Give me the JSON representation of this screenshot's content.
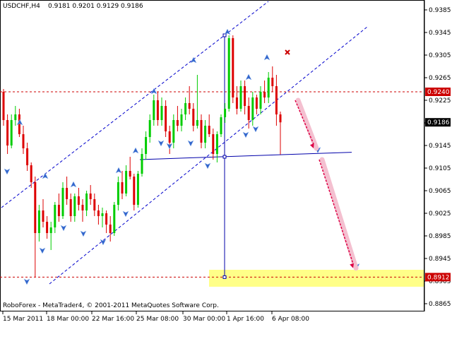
{
  "header": {
    "symbol": "USDCHF,H4",
    "ohlc": "0.9181 0.9201 0.9129 0.9186"
  },
  "footer": {
    "copyright": "RoboForex - MetaTrader4, © 2001-2011 MetaQuotes Software Corp."
  },
  "colors": {
    "bull": "#00cc00",
    "bear": "#dd0000",
    "level_line": "#cc0000",
    "channel": "#0000cc",
    "neckline": "#0000aa",
    "arrow_marker": "#3366cc",
    "target_zone": "#ffff88",
    "forecast_arrow": "#dd0044",
    "forecast_band": "#f4c0d0"
  },
  "chart_data": {
    "type": "candlestick",
    "y_range": [
      0.8855,
      0.94
    ],
    "y_ticks": [
      "0.9385",
      "0.9345",
      "0.9305",
      "0.9265",
      "0.9225",
      "0.9185",
      "0.9145",
      "0.9105",
      "0.9065",
      "0.9025",
      "0.8985",
      "0.8945",
      "0.8905",
      "0.8865"
    ],
    "x_ticks": [
      "15 Mar 2011",
      "18 Mar 00:00",
      "22 Mar 16:00",
      "25 Mar 08:00",
      "30 Mar 00:00",
      "1 Apr 16:00",
      "6 Apr 08:00"
    ],
    "levels": [
      {
        "label": "0.9240",
        "value": 0.924
      },
      {
        "label": "0.8912",
        "value": 0.8912
      }
    ],
    "current_price": {
      "label": "0.9186",
      "value": 0.9186
    },
    "candles": [
      [
        0.924,
        0.9245,
        0.918,
        0.919
      ],
      [
        0.919,
        0.92,
        0.913,
        0.9145
      ],
      [
        0.9145,
        0.92,
        0.914,
        0.919
      ],
      [
        0.919,
        0.9215,
        0.918,
        0.92
      ],
      [
        0.92,
        0.921,
        0.916,
        0.9165
      ],
      [
        0.9165,
        0.918,
        0.913,
        0.914
      ],
      [
        0.914,
        0.915,
        0.91,
        0.911
      ],
      [
        0.911,
        0.9115,
        0.907,
        0.908
      ],
      [
        0.908,
        0.909,
        0.8912,
        0.899
      ],
      [
        0.899,
        0.904,
        0.8975,
        0.903
      ],
      [
        0.903,
        0.905,
        0.9,
        0.901
      ],
      [
        0.901,
        0.902,
        0.898,
        0.899
      ],
      [
        0.899,
        0.901,
        0.896,
        0.9
      ],
      [
        0.9,
        0.9045,
        0.899,
        0.904
      ],
      [
        0.904,
        0.906,
        0.901,
        0.902
      ],
      [
        0.902,
        0.908,
        0.9015,
        0.907
      ],
      [
        0.907,
        0.909,
        0.904,
        0.905
      ],
      [
        0.905,
        0.906,
        0.901,
        0.902
      ],
      [
        0.902,
        0.906,
        0.901,
        0.9055
      ],
      [
        0.9055,
        0.907,
        0.903,
        0.904
      ],
      [
        0.904,
        0.905,
        0.901,
        0.903
      ],
      [
        0.903,
        0.9065,
        0.902,
        0.906
      ],
      [
        0.906,
        0.9075,
        0.904,
        0.905
      ],
      [
        0.905,
        0.906,
        0.902,
        0.903
      ],
      [
        0.903,
        0.904,
        0.9005,
        0.902
      ],
      [
        0.902,
        0.9035,
        0.9,
        0.9025
      ],
      [
        0.9025,
        0.903,
        0.899,
        0.9005
      ],
      [
        0.9005,
        0.902,
        0.8975,
        0.899
      ],
      [
        0.899,
        0.9045,
        0.8985,
        0.904
      ],
      [
        0.904,
        0.909,
        0.903,
        0.908
      ],
      [
        0.908,
        0.91,
        0.905,
        0.906
      ],
      [
        0.906,
        0.911,
        0.9055,
        0.91
      ],
      [
        0.91,
        0.9125,
        0.9085,
        0.909
      ],
      [
        0.909,
        0.9095,
        0.903,
        0.904
      ],
      [
        0.904,
        0.91,
        0.9035,
        0.9095
      ],
      [
        0.9095,
        0.914,
        0.909,
        0.913
      ],
      [
        0.913,
        0.917,
        0.912,
        0.916
      ],
      [
        0.916,
        0.92,
        0.915,
        0.919
      ],
      [
        0.919,
        0.9235,
        0.918,
        0.9225
      ],
      [
        0.9225,
        0.924,
        0.918,
        0.919
      ],
      [
        0.919,
        0.923,
        0.918,
        0.9215
      ],
      [
        0.9215,
        0.9225,
        0.916,
        0.917
      ],
      [
        0.917,
        0.918,
        0.913,
        0.915
      ],
      [
        0.915,
        0.92,
        0.914,
        0.919
      ],
      [
        0.919,
        0.9215,
        0.917,
        0.918
      ],
      [
        0.918,
        0.921,
        0.917,
        0.92
      ],
      [
        0.92,
        0.923,
        0.919,
        0.922
      ],
      [
        0.922,
        0.925,
        0.92,
        0.921
      ],
      [
        0.921,
        0.922,
        0.917,
        0.918
      ],
      [
        0.918,
        0.927,
        0.9175,
        0.919
      ],
      [
        0.919,
        0.92,
        0.914,
        0.915
      ],
      [
        0.915,
        0.919,
        0.914,
        0.918
      ],
      [
        0.918,
        0.92,
        0.916,
        0.9165
      ],
      [
        0.9165,
        0.9175,
        0.912,
        0.913
      ],
      [
        0.913,
        0.917,
        0.9115,
        0.9165
      ],
      [
        0.9165,
        0.92,
        0.916,
        0.9195
      ],
      [
        0.9195,
        0.922,
        0.9185,
        0.921
      ],
      [
        0.921,
        0.934,
        0.9205,
        0.9335
      ],
      [
        0.9335,
        0.934,
        0.922,
        0.923
      ],
      [
        0.923,
        0.925,
        0.92,
        0.921
      ],
      [
        0.921,
        0.926,
        0.9205,
        0.925
      ],
      [
        0.925,
        0.926,
        0.92,
        0.9215
      ],
      [
        0.9215,
        0.923,
        0.9175,
        0.919
      ],
      [
        0.919,
        0.924,
        0.918,
        0.923
      ],
      [
        0.923,
        0.9235,
        0.92,
        0.921
      ],
      [
        0.921,
        0.925,
        0.92,
        0.924
      ],
      [
        0.924,
        0.926,
        0.922,
        0.923
      ],
      [
        0.923,
        0.9275,
        0.922,
        0.9265
      ],
      [
        0.9265,
        0.9285,
        0.924,
        0.925
      ],
      [
        0.925,
        0.927,
        0.918,
        0.92
      ],
      [
        0.92,
        0.9205,
        0.9129,
        0.9186
      ]
    ]
  }
}
